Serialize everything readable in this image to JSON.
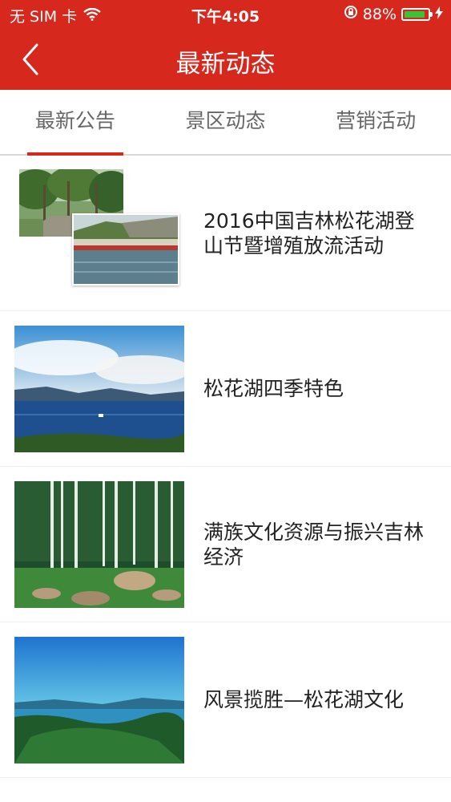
{
  "status_bar": {
    "carrier": "无 SIM 卡",
    "time": "下午4:05",
    "battery": "88%",
    "battery_level": 0.88
  },
  "nav": {
    "title": "最新动态"
  },
  "tabs": [
    {
      "label": "最新公告",
      "active": true
    },
    {
      "label": "景区动态",
      "active": false
    },
    {
      "label": "营销活动",
      "active": false
    }
  ],
  "articles": [
    {
      "title": "2016中国吉林松花湖登山节暨增殖放流活动"
    },
    {
      "title": "松花湖四季特色"
    },
    {
      "title": "满族文化资源与振兴吉林经济"
    },
    {
      "title": "风景揽胜—松花湖文化"
    }
  ],
  "colors": {
    "brand_red": "#d7281e",
    "battery_green": "#39c339"
  }
}
